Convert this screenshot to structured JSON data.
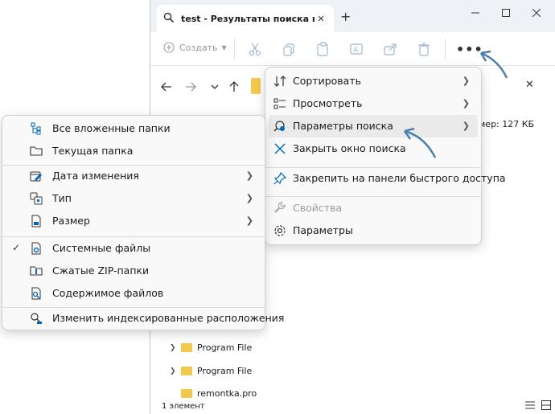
{
  "window": {
    "tab_title": "test - Результаты поиска в \"J",
    "toolbar": {
      "create_label": "Создать"
    },
    "info_size": "мер: 127 КБ",
    "tree": [
      {
        "label": "Program File"
      },
      {
        "label": "Program File"
      },
      {
        "label": "remontka.pro"
      }
    ],
    "status": "1 элемент"
  },
  "main_menu": {
    "items": [
      {
        "label": "Сортировать",
        "icon": "sort-icon",
        "submenu": true
      },
      {
        "label": "Просмотреть",
        "icon": "view-icon",
        "submenu": true
      },
      {
        "label": "Параметры поиска",
        "icon": "search-options-icon",
        "submenu": true,
        "highlighted": true
      },
      {
        "label": "Закрыть окно поиска",
        "icon": "close-icon",
        "submenu": false
      },
      {
        "label": "Закрепить на панели быстрого доступа",
        "icon": "pin-icon",
        "submenu": false
      },
      {
        "label": "Свойства",
        "icon": "wrench-icon",
        "submenu": false,
        "disabled": true
      },
      {
        "label": "Параметры",
        "icon": "gear-icon",
        "submenu": false
      }
    ]
  },
  "sub_menu": {
    "items": [
      {
        "label": "Все вложенные папки",
        "icon": "subfolders-icon"
      },
      {
        "label": "Текущая папка",
        "icon": "folder-icon"
      },
      {
        "label": "Дата изменения",
        "icon": "calendar-icon",
        "submenu": true
      },
      {
        "label": "Тип",
        "icon": "type-icon",
        "submenu": true
      },
      {
        "label": "Размер",
        "icon": "size-icon",
        "submenu": true
      },
      {
        "label": "Системные файлы",
        "icon": "system-file-icon",
        "checked": true
      },
      {
        "label": "Сжатые ZIP-папки",
        "icon": "zip-folder-icon"
      },
      {
        "label": "Содержимое файлов",
        "icon": "file-content-icon"
      },
      {
        "label": "Изменить индексированные расположения",
        "icon": "index-icon"
      }
    ]
  },
  "colors": {
    "accent": "#0067c0",
    "highlight": "#eaeaea",
    "arrow": "#4a7fb0",
    "folder": "#f2c94c"
  }
}
